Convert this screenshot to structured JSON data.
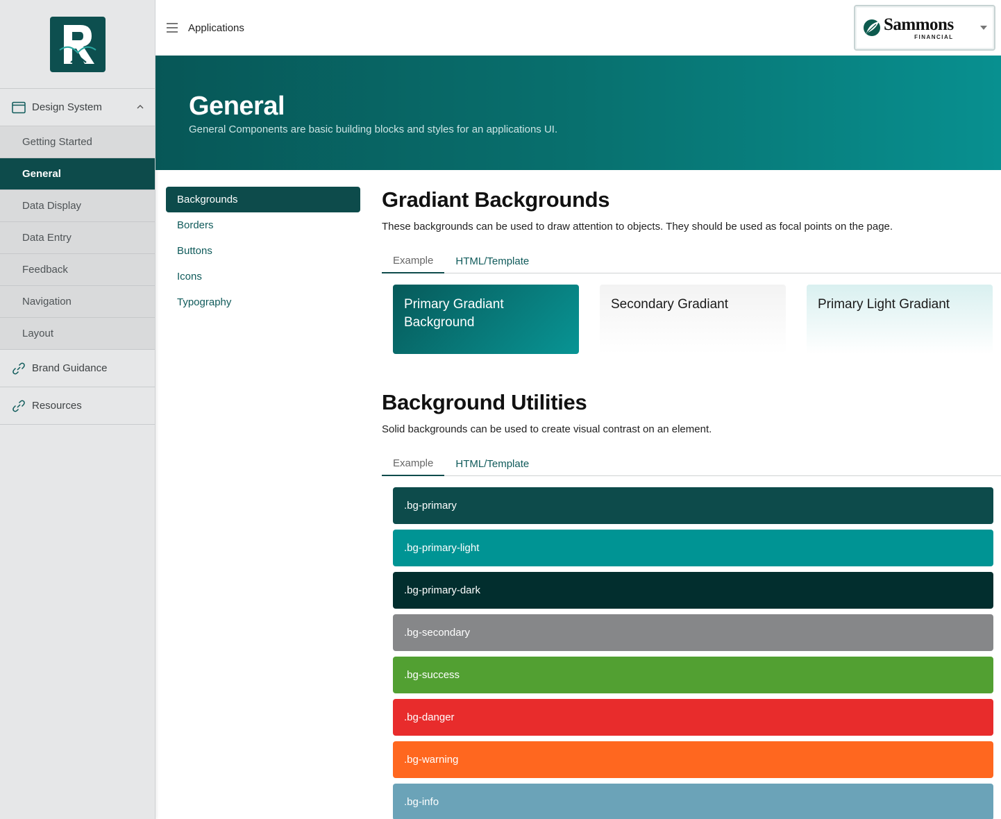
{
  "sidebar": {
    "design_system": "Design System",
    "items": [
      {
        "label": "Getting Started"
      },
      {
        "label": "General"
      },
      {
        "label": "Data Display"
      },
      {
        "label": "Data Entry"
      },
      {
        "label": "Feedback"
      },
      {
        "label": "Navigation"
      },
      {
        "label": "Layout"
      }
    ],
    "active_item": "General",
    "brand_guidance": "Brand Guidance",
    "resources": "Resources"
  },
  "topbar": {
    "title": "Applications",
    "brand": "Sammons",
    "brand_sub": "FINANCIAL"
  },
  "hero": {
    "title": "General",
    "subtitle": "General Components are basic building blocks and styles for an applications UI."
  },
  "subnav": {
    "items": [
      {
        "label": "Backgrounds"
      },
      {
        "label": "Borders"
      },
      {
        "label": "Buttons"
      },
      {
        "label": "Icons"
      },
      {
        "label": "Typography"
      }
    ],
    "active_item": "Backgrounds"
  },
  "gradients": {
    "title": "Gradiant Backgrounds",
    "description": "These backgrounds can be used to draw attention to objects. They should be used as focal points on the page.",
    "tabs": [
      "Example",
      "HTML/Template"
    ],
    "cards": [
      {
        "label": "Primary Gradiant Background"
      },
      {
        "label": "Secondary Gradiant"
      },
      {
        "label": "Primary Light Gradiant"
      }
    ]
  },
  "utilities": {
    "title": "Background Utilities",
    "description": "Solid backgrounds can be used to create visual contrast on an element.",
    "tabs": [
      "Example",
      "HTML/Template"
    ],
    "rows": [
      {
        "label": ".bg-primary",
        "color": "#0d4b4b"
      },
      {
        "label": ".bg-primary-light",
        "color": "#009494"
      },
      {
        "label": ".bg-primary-dark",
        "color": "#022e2e"
      },
      {
        "label": ".bg-secondary",
        "color": "#868789"
      },
      {
        "label": ".bg-success",
        "color": "#52a032"
      },
      {
        "label": ".bg-danger",
        "color": "#e82c2c"
      },
      {
        "label": ".bg-warning",
        "color": "#ff671f"
      },
      {
        "label": ".bg-info",
        "color": "#6ba3b8"
      }
    ]
  },
  "colors": {
    "primary": "#0d4b4b",
    "link": "#0f5a5a"
  }
}
